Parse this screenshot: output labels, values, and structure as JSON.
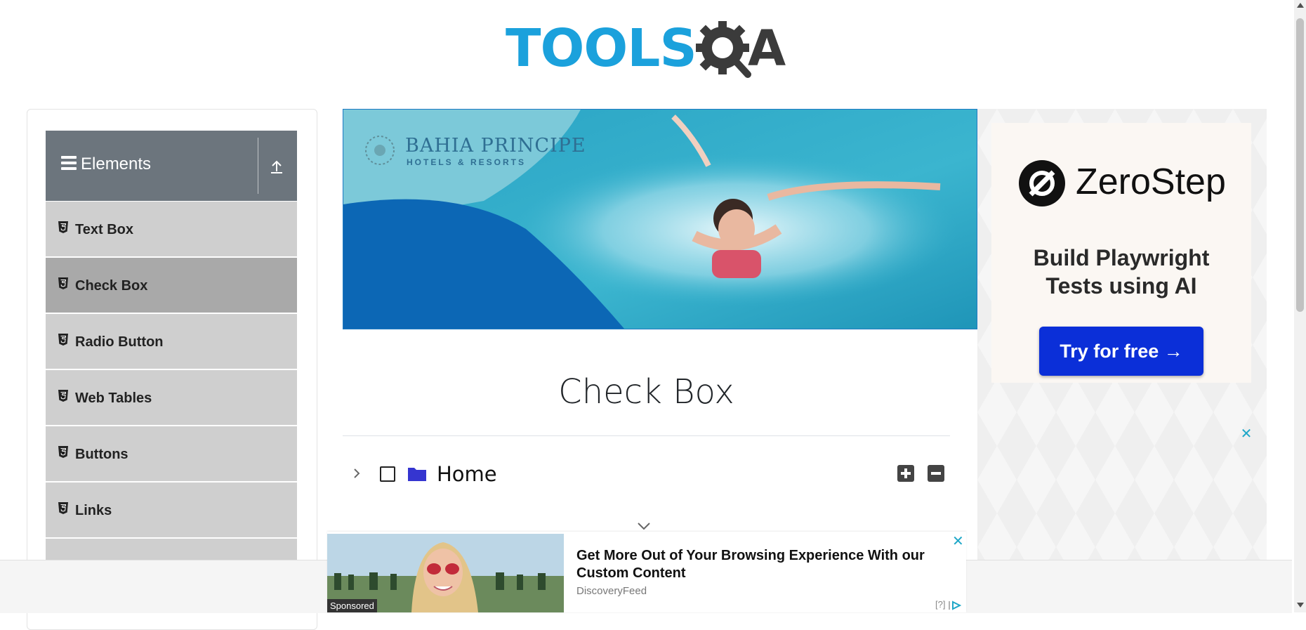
{
  "header": {
    "logo_text_tools": "TOOLS",
    "logo_text_a": "A",
    "brand_colors": {
      "tools": "#1ba1dc",
      "qa": "#3b3b3b"
    }
  },
  "sidebar": {
    "group_title": "Elements",
    "colors": {
      "header_bg": "#6c757d",
      "item_bg": "#cfcfcf",
      "active_bg": "#a9a9a9"
    },
    "items": [
      {
        "label": "Text Box",
        "active": false
      },
      {
        "label": "Check Box",
        "active": true
      },
      {
        "label": "Radio Button",
        "active": false
      },
      {
        "label": "Web Tables",
        "active": false
      },
      {
        "label": "Buttons",
        "active": false
      },
      {
        "label": "Links",
        "active": false
      }
    ]
  },
  "banner_ad": {
    "brand": "BAHIA PRINCIPE",
    "subtitle": "HOTELS & RESORTS"
  },
  "main": {
    "page_title": "Check Box",
    "tree": {
      "root_label": "Home",
      "checked": false,
      "expanded": false
    }
  },
  "right_ad": {
    "brand": "ZeroStep",
    "tagline_line1": "Build Playwright",
    "tagline_line2": "Tests using AI",
    "cta": "Try for free →",
    "cta_color": "#0b2fd8",
    "close": "✕"
  },
  "bottom_ad": {
    "sponsored_label": "Sponsored",
    "headline": "Get More Out of Your Browsing Experience With our Custom Content",
    "source": "DiscoveryFeed",
    "choices": "[?]",
    "close": "✕"
  }
}
